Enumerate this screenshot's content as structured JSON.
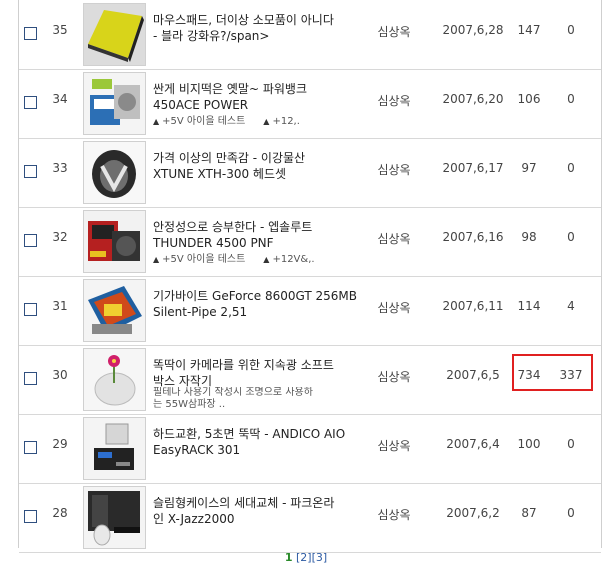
{
  "posts": [
    {
      "num": "35",
      "title": "마우스패드, 더이상 소모품이 아니다\n- 블라 강화유?/span>",
      "sub": [],
      "author": "심상옥",
      "date": "2007,6,28",
      "hits": "147",
      "reco": "0",
      "thumb": "yellow-mousepad"
    },
    {
      "num": "34",
      "title": "싼게 비지떡은 옛말~ 파워뱅크\n450ACE POWER",
      "sub": [
        "+5V 아이을 테스트",
        "+12,."
      ],
      "author": "심상옥",
      "date": "2007,6,20",
      "hits": "106",
      "reco": "0",
      "thumb": "power-supply-box"
    },
    {
      "num": "33",
      "title": "가격 이상의 만족감 - 이강물산\nXTUNE XTH-300 헤드셋",
      "sub": [],
      "author": "심상옥",
      "date": "2007,6,17",
      "hits": "97",
      "reco": "0",
      "thumb": "headset"
    },
    {
      "num": "32",
      "title": "안정성으로 승부한다 - 엡솔루트\nTHUNDER 4500 PNF",
      "sub": [
        "+5V 아이을 테스트",
        "+12V&,."
      ],
      "author": "심상옥",
      "date": "2007,6,16",
      "hits": "98",
      "reco": "0",
      "thumb": "power-supply-red"
    },
    {
      "num": "31",
      "title": "기가바이트 GeForce 8600GT 256MB\nSilent-Pipe 2,51",
      "sub": [],
      "author": "심상옥",
      "date": "2007,6,11",
      "hits": "114",
      "reco": "4",
      "thumb": "graphics-card"
    },
    {
      "num": "30",
      "title": "똑딱이 카메라를 위한 지속광 소프트\n박스 자작기",
      "sub2": "필테나 사용기 작성시 조명으로 사용하\n는 55W삼파장 ..",
      "author": "심상옥",
      "date": "2007,6,5",
      "hits": "734",
      "reco": "337",
      "thumb": "softbox-flower"
    },
    {
      "num": "29",
      "title": "하드교환, 5초면 뚝딱 - ANDICO AIO\nEasyRACK 301",
      "sub": [],
      "author": "심상옥",
      "date": "2007,6,4",
      "hits": "100",
      "reco": "0",
      "thumb": "hdd-rack"
    },
    {
      "num": "28",
      "title": "슬림형케이스의 세대교체 - 파크온라\n인 X-Jazz2000",
      "sub": [],
      "author": "심상옥",
      "date": "2007,6,2",
      "hits": "87",
      "reco": "0",
      "thumb": "slim-case"
    }
  ],
  "pagination": {
    "current": "1",
    "pages": [
      "[2]",
      "[3]"
    ]
  },
  "colors": {
    "highlight": "#e02020",
    "checkbox": "#2f4f7f",
    "current_page": "#2a8a2a",
    "page_link": "#2d5ba3"
  }
}
